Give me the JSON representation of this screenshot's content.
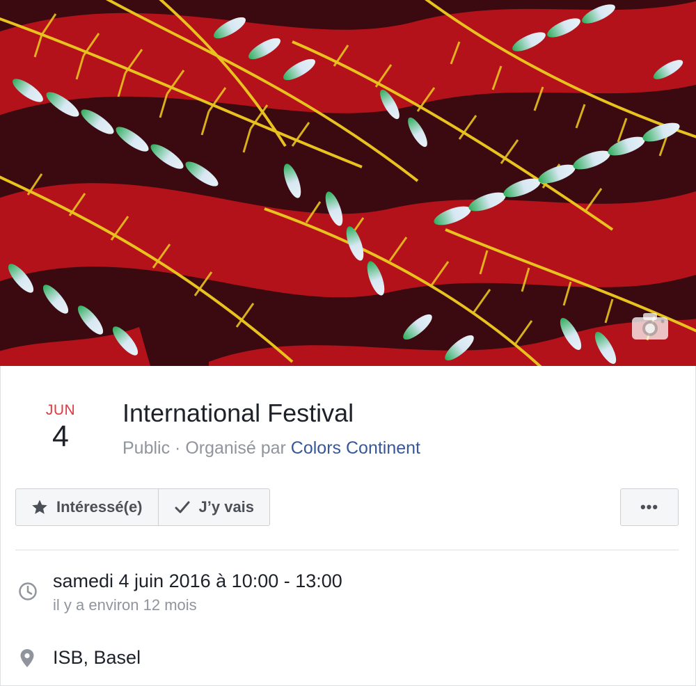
{
  "event": {
    "month": "JUN",
    "day": "4",
    "title": "International Festival",
    "privacy": "Public",
    "separator": " · ",
    "organized_by": "Organisé par",
    "organizer": "Colors Continent"
  },
  "actions": {
    "interested_label": "Intéressé(e)",
    "going_label": "J’y vais",
    "more_label": "•••"
  },
  "details": {
    "datetime": "samedi 4 juin 2016 à 10:00 - 13:00",
    "relative_time": "il y a environ 12 mois",
    "location": "ISB, Basel"
  },
  "icons": {
    "camera": "camera-icon",
    "star": "star-icon",
    "check": "check-icon",
    "clock": "clock-icon",
    "pin": "location-pin-icon"
  },
  "colors": {
    "month_red": "#e0393e",
    "link_blue": "#365899",
    "secondary_text": "#90949c",
    "cover_red": "#b3121a",
    "cover_dark": "#3a0a10",
    "cover_yellow": "#e8c21e",
    "cover_green": "#2fae5c"
  }
}
